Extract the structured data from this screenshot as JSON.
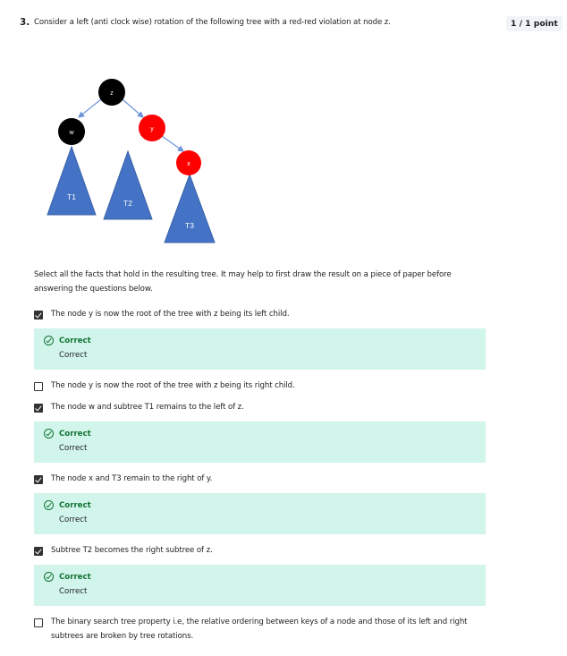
{
  "question": {
    "number": "3.",
    "text": "Consider a left (anti clock wise) rotation of the following tree with a red-red violation at node z.",
    "score": "1 / 1 point"
  },
  "tree": {
    "nodes": [
      {
        "label": "z",
        "color": "#000000",
        "text_color": "#ffffff"
      },
      {
        "label": "w",
        "color": "#000000",
        "text_color": "#ffffff"
      },
      {
        "label": "y",
        "color": "#ff0000",
        "text_color": "#ffffff"
      },
      {
        "label": "x",
        "color": "#ff0000",
        "text_color": "#ffffff"
      }
    ],
    "subtrees": [
      "T1",
      "T2",
      "T3"
    ],
    "triangle_color": "#4472c4",
    "edge_color": "#6b93d6"
  },
  "prompt": "Select all the facts that hold in the resulting tree. It may help to first draw the result on a piece of paper before answering the questions below.",
  "options": [
    {
      "label": "The node y is now the root of the tree with z being its left child.",
      "checked": true,
      "feedback": {
        "title": "Correct",
        "text": "Correct"
      }
    },
    {
      "label": "The node y is now the root of the tree with z being its right child.",
      "checked": false
    },
    {
      "label": "The node w and subtree T1 remains to the left of z.",
      "checked": true,
      "feedback": {
        "title": "Correct",
        "text": "Correct"
      }
    },
    {
      "label": "The node x and T3 remain to the right of y.",
      "checked": true,
      "feedback": {
        "title": "Correct",
        "text": "Correct"
      }
    },
    {
      "label": "Subtree T2 becomes the right subtree of z.",
      "checked": true,
      "feedback": {
        "title": "Correct",
        "text": "Correct"
      }
    },
    {
      "label": "The binary search tree property i.e, the relative ordering between keys of a node and those of its left and right subtrees are broken by tree rotations.",
      "checked": false
    }
  ],
  "colors": {
    "feedback_bg": "#d1f5eb",
    "correct_green": "#137333"
  }
}
